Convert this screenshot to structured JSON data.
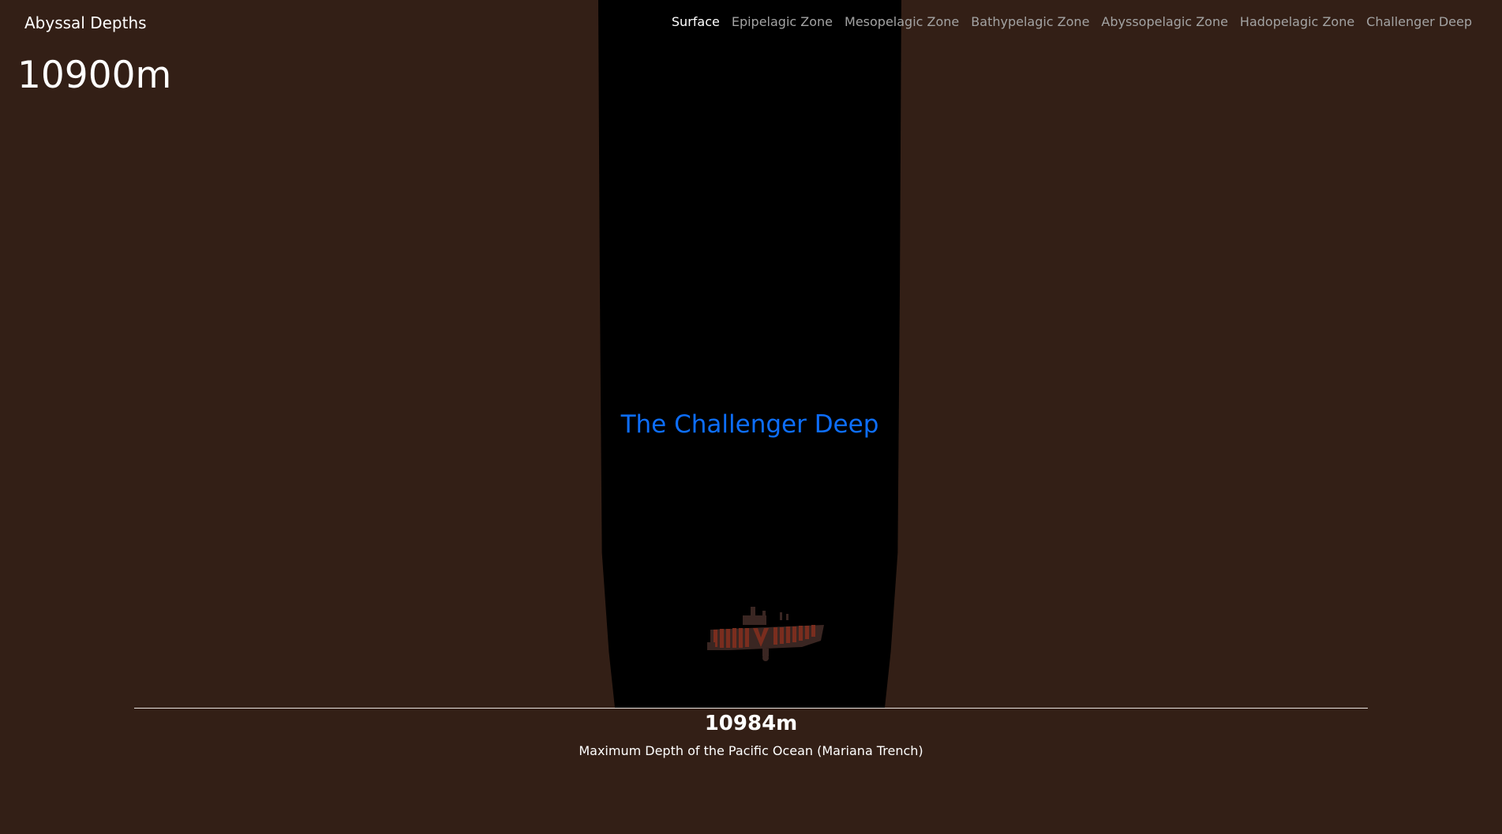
{
  "brand": {
    "title": "Abyssal Depths"
  },
  "current_depth": "10900m",
  "nav": {
    "items": [
      {
        "label": "Surface"
      },
      {
        "label": "Epipelagic Zone"
      },
      {
        "label": "Mesopelagic Zone"
      },
      {
        "label": "Bathypelagic Zone"
      },
      {
        "label": "Abyssopelagic Zone"
      },
      {
        "label": "Hadopelagic Zone"
      },
      {
        "label": "Challenger Deep"
      }
    ]
  },
  "zone": {
    "title": "The Challenger Deep"
  },
  "bottom": {
    "max_depth": "10984m",
    "caption": "Maximum Depth of the Pacific Ocean (Mariana Trench)"
  },
  "colors": {
    "background": "#331f16",
    "trench": "#000000",
    "accent": "#0d6efd",
    "nav_active": "#ffffff",
    "nav_inactive": "#a3a3a3"
  },
  "icons": {
    "vessel": "submarine-icon"
  }
}
